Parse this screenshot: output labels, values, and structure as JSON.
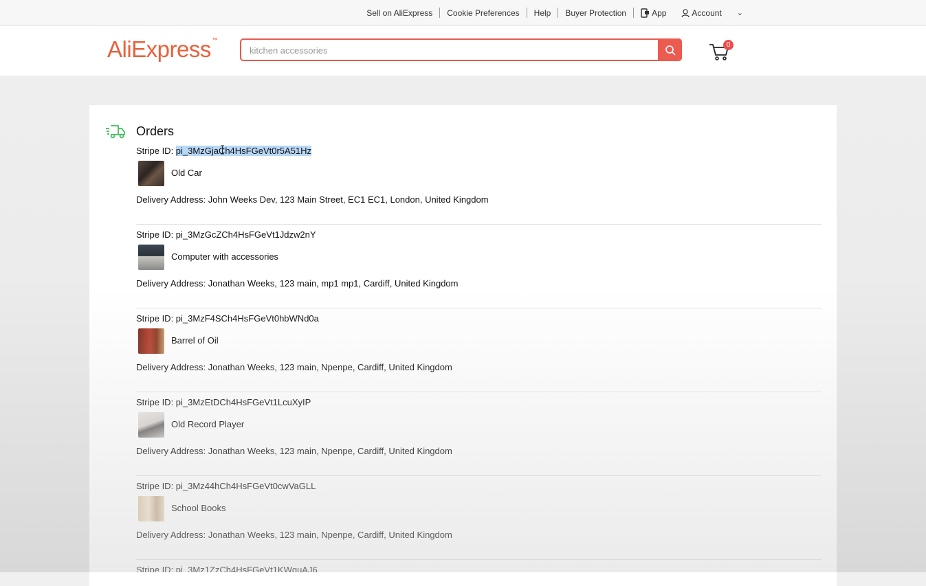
{
  "topnav": {
    "sell": "Sell on AliExpress",
    "cookie": "Cookie Preferences",
    "help": "Help",
    "buyer_protection": "Buyer Protection",
    "app": "App",
    "account": "Account"
  },
  "header": {
    "logo": "AliExpress",
    "search_placeholder": "kitchen accessories",
    "cart_count": "0"
  },
  "main": {
    "title": "Orders",
    "stripe_label": "Stripe ID: ",
    "address_label": "Delivery Address: ",
    "orders": [
      {
        "stripe_id": "pi_3MzGjaCh4HsFGeVt0r5A51Hz",
        "product": "Old Car",
        "address": "John Weeks Dev, 123 Main Street, EC1 EC1, London, United Kingdom"
      },
      {
        "stripe_id": "pi_3MzGcZCh4HsFGeVt1Jdzw2nY",
        "product": "Computer with accessories",
        "address": "Jonathan Weeks, 123 main, mp1 mp1, Cardiff, United Kingdom"
      },
      {
        "stripe_id": "pi_3MzF4SCh4HsFGeVt0hbWNd0a",
        "product": "Barrel of Oil",
        "address": "Jonathan Weeks, 123 main, Npenpe, Cardiff, United Kingdom"
      },
      {
        "stripe_id": "pi_3MzEtDCh4HsFGeVt1LcuXyIP",
        "product": "Old Record Player",
        "address": "Jonathan Weeks, 123 main, Npenpe, Cardiff, United Kingdom"
      },
      {
        "stripe_id": "pi_3Mz44hCh4HsFGeVt0cwVaGLL",
        "product": "School Books",
        "address": "Jonathan Weeks, 123 main, Npenpe, Cardiff, United Kingdom"
      },
      {
        "stripe_id": "pi_3Mz1ZzCh4HsFGeVt1KWguAJ6",
        "product": "",
        "address": ""
      }
    ]
  },
  "colors": {
    "brand": "#e8613c",
    "accent": "#ec5b50",
    "selection": "#b7d7f7",
    "truck_icon": "#3fbf5b"
  }
}
